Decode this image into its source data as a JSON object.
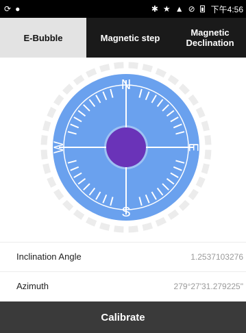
{
  "status_bar": {
    "left_icons": [
      "sync-icon",
      "location-icon"
    ],
    "right_icons": [
      "bluetooth-icon",
      "star-icon",
      "signal-icon",
      "mute-icon",
      "battery-icon"
    ],
    "time": "下午4:56"
  },
  "tabs": [
    {
      "label": "E-Bubble",
      "active": true
    },
    {
      "label": "Magnetic step",
      "active": false
    },
    {
      "label": "Magnetic\nDeclination",
      "active": false
    }
  ],
  "compass": {
    "north": "N",
    "south": "S",
    "east": "E",
    "west": "W",
    "colors": {
      "dial": "#6aa1ee",
      "bubble": "#6a33b8",
      "outer_ring": "#ededed"
    }
  },
  "readings": {
    "inclination_label": "Inclination Angle",
    "inclination_value": "1.2537103276",
    "azimuth_label": "Azimuth",
    "azimuth_value": "279°27'31.279225\""
  },
  "calibrate_label": "Calibrate"
}
